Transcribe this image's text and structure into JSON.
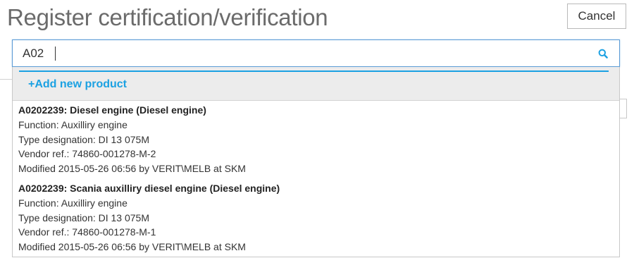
{
  "page": {
    "title": "Register certification/verification",
    "cancel_label": "Cancel"
  },
  "search": {
    "value": "A02",
    "icon": "search-icon"
  },
  "dropdown": {
    "add_new_label": "+Add new product",
    "results": [
      {
        "title": "A0202239: Diesel engine (Diesel engine)",
        "function": "Function: Auxilliry engine",
        "type_designation": "Type designation: DI 13 075M",
        "vendor_ref": "Vendor ref.: 74860-001278-M-2",
        "modified": "Modified 2015-05-26 06:56 by VERIT\\MELB at SKM"
      },
      {
        "title": "A0202239: Scania auxilliry diesel engine (Diesel engine)",
        "function": "Function: Auxilliry engine",
        "type_designation": "Type designation: DI 13 075M",
        "vendor_ref": "Vendor ref.: 74860-001278-M-1",
        "modified": "Modified 2015-05-26 06:56 by VERIT\\MELB at SKM"
      }
    ]
  },
  "colors": {
    "accent": "#1ba1e2",
    "focus_border": "#5b9bd5",
    "title_gray": "#6b6b6b",
    "add_row_bg": "#ececec"
  }
}
